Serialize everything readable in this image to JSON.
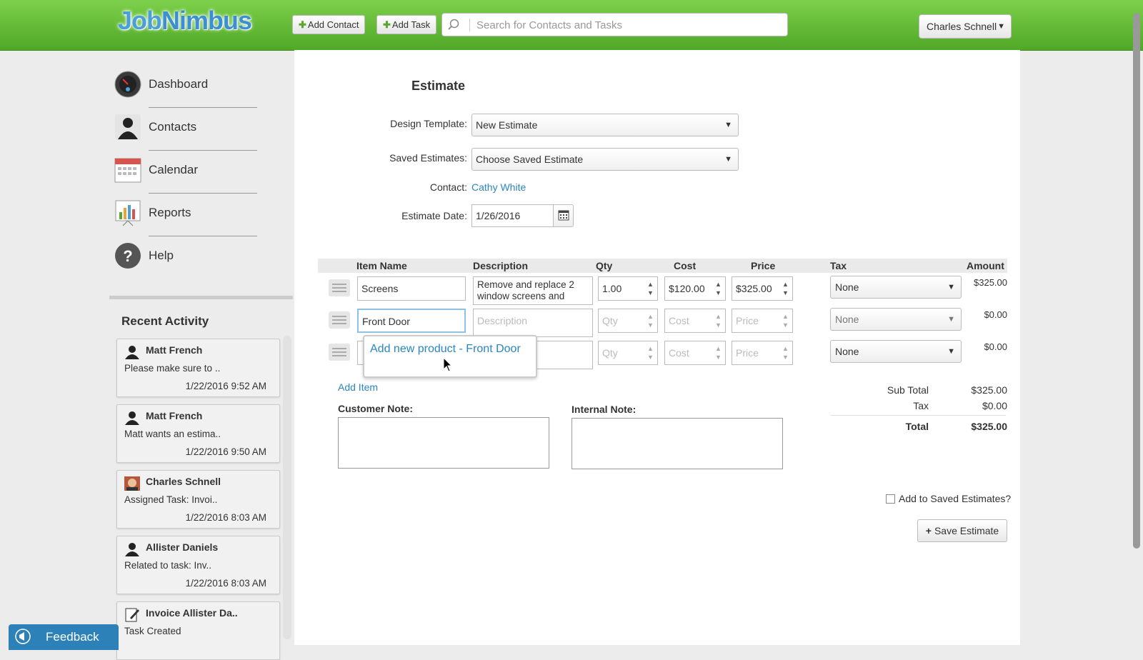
{
  "header": {
    "logo_text_a": "Job",
    "logo_text_b": "Nimbus",
    "add_contact_label": "Add Contact",
    "add_task_label": "Add Task",
    "search_placeholder": "Search for Contacts and Tasks",
    "user_name": "Charles Schnell"
  },
  "sidebar": {
    "nav": [
      {
        "label": "Dashboard",
        "icon": "dashboard-icon"
      },
      {
        "label": "Contacts",
        "icon": "person-icon"
      },
      {
        "label": "Calendar",
        "icon": "calendar-icon"
      },
      {
        "label": "Reports",
        "icon": "bar-chart-icon"
      },
      {
        "label": "Help",
        "icon": "help-icon"
      }
    ],
    "recent_title": "Recent Activity",
    "activity": [
      {
        "name": "Matt French",
        "text": "Please make sure to ..",
        "date": "1/22/2016 9:52 AM",
        "icon": "person-icon"
      },
      {
        "name": "Matt French",
        "text": "Matt wants an estima..",
        "date": "1/22/2016 9:50 AM",
        "icon": "person-icon"
      },
      {
        "name": "Charles Schnell",
        "text": "Assigned Task: Invoi..",
        "date": "1/22/2016 8:03 AM",
        "icon": "avatar-photo-icon"
      },
      {
        "name": "Allister Daniels",
        "text": "Related to task: Inv..",
        "date": "1/22/2016 8:03 AM",
        "icon": "person-icon"
      },
      {
        "name": "Invoice Allister Da..",
        "text": "Task Created",
        "date": "",
        "icon": "edit-note-icon"
      }
    ],
    "feedback_label": "Feedback"
  },
  "estimate": {
    "title": "Estimate",
    "design_template_label": "Design Template:",
    "design_template_value": "New Estimate",
    "saved_estimates_label": "Saved Estimates:",
    "saved_estimates_value": "Choose Saved Estimate",
    "contact_label": "Contact:",
    "contact_value": "Cathy White",
    "date_label": "Estimate Date:",
    "date_value": "1/26/2016",
    "columns": [
      "Item Name",
      "Description",
      "Qty",
      "Cost",
      "Price",
      "Tax",
      "Amount"
    ],
    "rows": [
      {
        "item": "Screens",
        "description": "Remove and replace 2 window screens and",
        "qty": "1.00",
        "cost": "$120.00",
        "price": "$325.00",
        "tax": "None",
        "amount": "$325.00"
      },
      {
        "item": "Front Door",
        "description": "",
        "qty": "",
        "cost": "",
        "price": "",
        "tax": "None",
        "amount": "$0.00"
      },
      {
        "item": "",
        "description": "",
        "qty": "",
        "cost": "",
        "price": "",
        "tax": "None",
        "amount": "$0.00"
      }
    ],
    "placeholders": {
      "description": "Description",
      "qty": "Qty",
      "cost": "Cost",
      "price": "Price"
    },
    "autocomplete_option": "Add new product - Front Door",
    "add_item_label": "Add Item",
    "customer_note_label": "Customer Note:",
    "internal_note_label": "Internal Note:",
    "totals": {
      "subtotal_label": "Sub Total",
      "subtotal_value": "$325.00",
      "tax_label": "Tax",
      "tax_value": "$0.00",
      "total_label": "Total",
      "total_value": "$325.00"
    },
    "add_to_saved_label": "Add to Saved Estimates?",
    "save_label": "Save Estimate"
  }
}
